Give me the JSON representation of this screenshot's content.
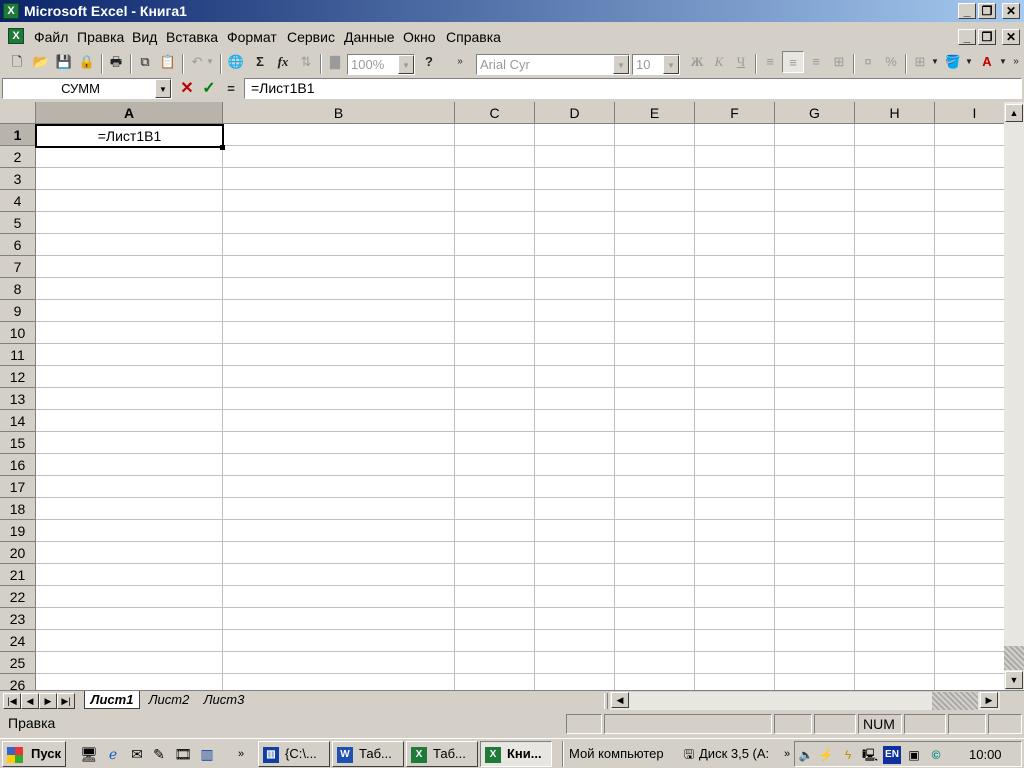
{
  "window": {
    "title": "Microsoft Excel - Книга1"
  },
  "menu": [
    "Файл",
    "Правка",
    "Вид",
    "Вставка",
    "Формат",
    "Сервис",
    "Данные",
    "Окно",
    "Справка"
  ],
  "toolbar": {
    "zoom": "100%",
    "font": "Arial Cyr",
    "size": "10"
  },
  "formula_bar": {
    "name_box": "СУММ",
    "formula": "=Лист1B1",
    "equals": "="
  },
  "columns": [
    "A",
    "B",
    "C",
    "D",
    "E",
    "F",
    "G",
    "H",
    "I"
  ],
  "rows": [
    "1",
    "2",
    "3",
    "4",
    "5",
    "6",
    "7",
    "8",
    "9",
    "10",
    "11",
    "12",
    "13",
    "14",
    "15",
    "16",
    "17",
    "18",
    "19",
    "20",
    "21",
    "22",
    "23",
    "24",
    "25",
    "26"
  ],
  "cell_A1": "=Лист1B1",
  "sheets": [
    "Лист1",
    "Лист2",
    "Лист3"
  ],
  "status": {
    "mode": "Правка",
    "num": "NUM"
  },
  "taskbar": {
    "start": "Пуск",
    "tasks": [
      "{C:\\...",
      "Таб...",
      "Таб...",
      "Кни..."
    ],
    "address": "Мой компьютер",
    "disk": "Диск 3,5 (А:",
    "lang": "EN",
    "clock": "10:00"
  },
  "colors": {
    "title_start": "#0a246a",
    "title_end": "#a6caf0",
    "excel_green": "#1f7a3a"
  }
}
